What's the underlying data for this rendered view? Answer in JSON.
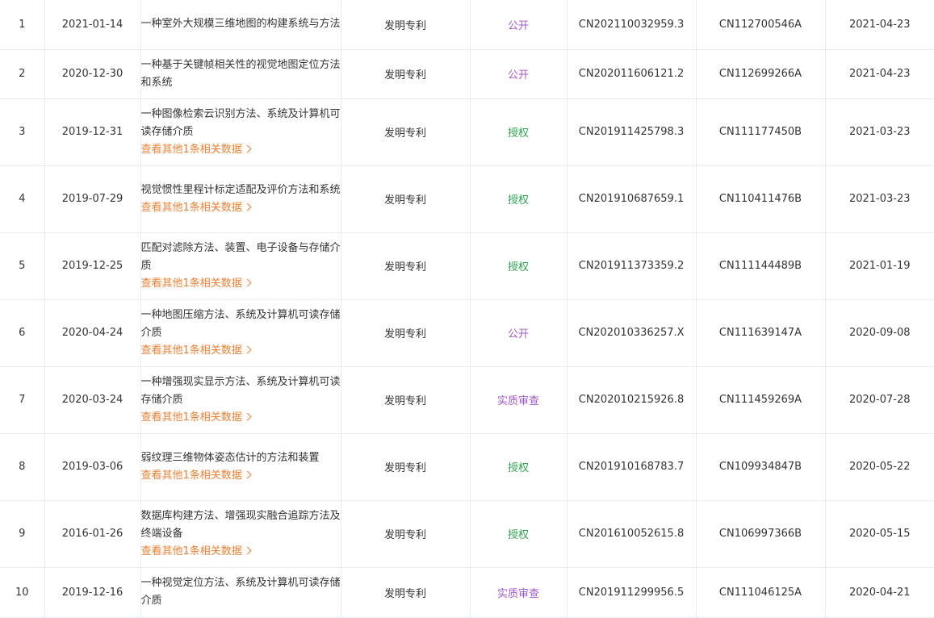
{
  "table": {
    "rows": [
      {
        "index": "1",
        "app_date": "2021-01-14",
        "title": "一种室外大规模三维地图的构建系统与方法",
        "type": "发明专利",
        "status": "公开",
        "status_kind": "public",
        "app_no": "CN202110032959.3",
        "pub_no": "CN112700546A",
        "pub_date": "2021-04-23",
        "related": ""
      },
      {
        "index": "2",
        "app_date": "2020-12-30",
        "title": "一种基于关键帧相关性的视觉地图定位方法和系统",
        "type": "发明专利",
        "status": "公开",
        "status_kind": "public",
        "app_no": "CN202011606121.2",
        "pub_no": "CN112699266A",
        "pub_date": "2021-04-23",
        "related": ""
      },
      {
        "index": "3",
        "app_date": "2019-12-31",
        "title": "一种图像检索云识别方法、系统及计算机可读存储介质",
        "type": "发明专利",
        "status": "授权",
        "status_kind": "granted",
        "app_no": "CN201911425798.3",
        "pub_no": "CN111177450B",
        "pub_date": "2021-03-23",
        "related": "查看其他1条相关数据"
      },
      {
        "index": "4",
        "app_date": "2019-07-29",
        "title": "视觉惯性里程计标定适配及评价方法和系统",
        "type": "发明专利",
        "status": "授权",
        "status_kind": "granted",
        "app_no": "CN201910687659.1",
        "pub_no": "CN110411476B",
        "pub_date": "2021-03-23",
        "related": "查看其他1条相关数据"
      },
      {
        "index": "5",
        "app_date": "2019-12-25",
        "title": "匹配对滤除方法、装置、电子设备与存储介质",
        "type": "发明专利",
        "status": "授权",
        "status_kind": "granted",
        "app_no": "CN201911373359.2",
        "pub_no": "CN111144489B",
        "pub_date": "2021-01-19",
        "related": "查看其他1条相关数据"
      },
      {
        "index": "6",
        "app_date": "2020-04-24",
        "title": "一种地图压缩方法、系统及计算机可读存储介质",
        "type": "发明专利",
        "status": "公开",
        "status_kind": "public",
        "app_no": "CN202010336257.X",
        "pub_no": "CN111639147A",
        "pub_date": "2020-09-08",
        "related": "查看其他1条相关数据"
      },
      {
        "index": "7",
        "app_date": "2020-03-24",
        "title": "一种增强现实显示方法、系统及计算机可读存储介质",
        "type": "发明专利",
        "status": "实质审查",
        "status_kind": "review",
        "app_no": "CN202010215926.8",
        "pub_no": "CN111459269A",
        "pub_date": "2020-07-28",
        "related": "查看其他1条相关数据"
      },
      {
        "index": "8",
        "app_date": "2019-03-06",
        "title": "弱纹理三维物体姿态估计的方法和装置",
        "type": "发明专利",
        "status": "授权",
        "status_kind": "granted",
        "app_no": "CN201910168783.7",
        "pub_no": "CN109934847B",
        "pub_date": "2020-05-22",
        "related": "查看其他1条相关数据"
      },
      {
        "index": "9",
        "app_date": "2016-01-26",
        "title": "数据库构建方法、增强现实融合追踪方法及终端设备",
        "type": "发明专利",
        "status": "授权",
        "status_kind": "granted",
        "app_no": "CN201610052615.8",
        "pub_no": "CN106997366B",
        "pub_date": "2020-05-15",
        "related": "查看其他1条相关数据"
      },
      {
        "index": "10",
        "app_date": "2019-12-16",
        "title": "一种视觉定位方法、系统及计算机可读存储介质",
        "type": "发明专利",
        "status": "实质审查",
        "status_kind": "review",
        "app_no": "CN201911299956.5",
        "pub_no": "CN111046125A",
        "pub_date": "2020-04-21",
        "related": ""
      }
    ]
  },
  "colors": {
    "link": "#f07f2f",
    "status_public": "#a15bc8",
    "status_granted": "#2ea44f",
    "status_review": "#a15bc8",
    "border": "#e9ecef",
    "text": "#333333"
  }
}
